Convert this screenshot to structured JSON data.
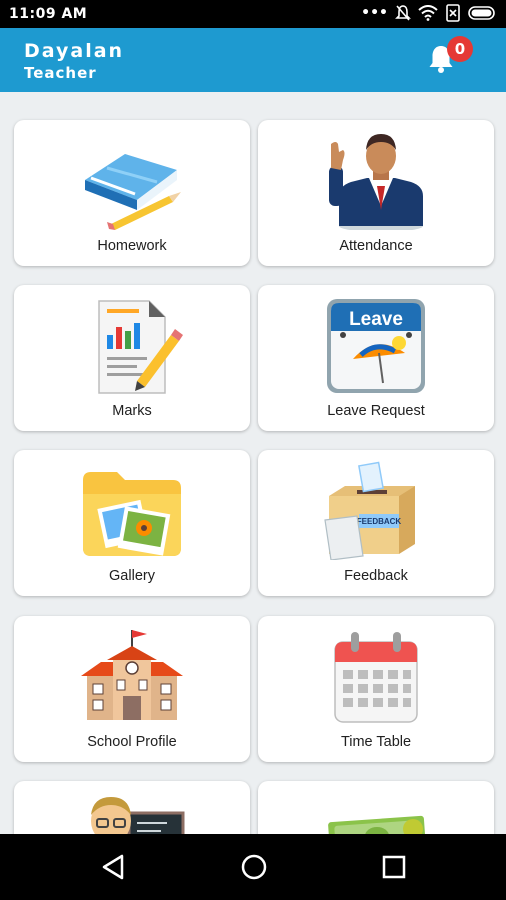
{
  "status_bar": {
    "time": "11:09 AM"
  },
  "header": {
    "name": "Dayalan",
    "role": "Teacher",
    "notification_count": "0"
  },
  "menu": [
    {
      "label": "Homework",
      "icon": "homework-book-icon"
    },
    {
      "label": "Attendance",
      "icon": "attendance-person-icon"
    },
    {
      "label": "Marks",
      "icon": "marks-report-icon"
    },
    {
      "label": "Leave Request",
      "icon": "leave-calendar-icon"
    },
    {
      "label": "Gallery",
      "icon": "gallery-folder-icon"
    },
    {
      "label": "Feedback",
      "icon": "feedback-box-icon"
    },
    {
      "label": "School Profile",
      "icon": "school-building-icon"
    },
    {
      "label": "Time Table",
      "icon": "timetable-calendar-icon"
    },
    {
      "label": "",
      "icon": "teacher-blackboard-icon"
    },
    {
      "label": "",
      "icon": "money-icon"
    }
  ],
  "icon_texts": {
    "leave": "Leave",
    "feedback": "FEEDBACK"
  },
  "colors": {
    "appbar": "#1e9ad0",
    "badge": "#e53935",
    "background": "#eceff1"
  }
}
